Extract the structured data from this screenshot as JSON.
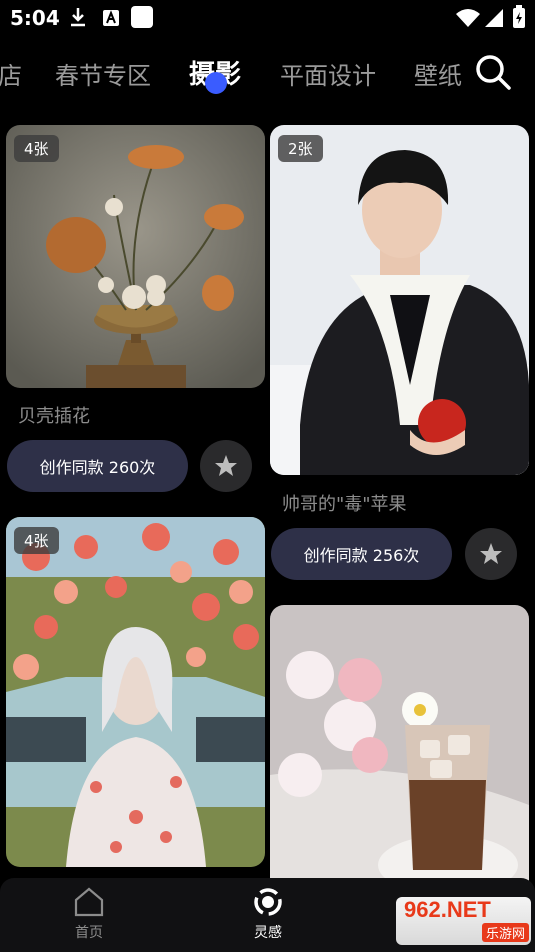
{
  "status_bar": {
    "time": "5:04"
  },
  "category_tabs": [
    "店",
    "春节专区",
    "摄影",
    "平面设计",
    "壁纸"
  ],
  "active_tab_index": 2,
  "cards": [
    {
      "badge": "4张",
      "title": "贝壳插花",
      "action_label": "创作同款 260次"
    },
    {
      "badge": "2张",
      "title": "帅哥的\"毒\"苹果",
      "action_label": "创作同款 256次"
    },
    {
      "badge": "4张"
    },
    {}
  ],
  "bottom_nav": [
    {
      "label": "首页",
      "icon": "home-icon"
    },
    {
      "label": "灵感",
      "icon": "inspiration-icon"
    }
  ],
  "watermark": {
    "top": "962.NET",
    "bottom": "乐游网"
  },
  "colors": {
    "accent": "#3a5cff",
    "background": "#000000",
    "button_bg": "#2e3048"
  }
}
